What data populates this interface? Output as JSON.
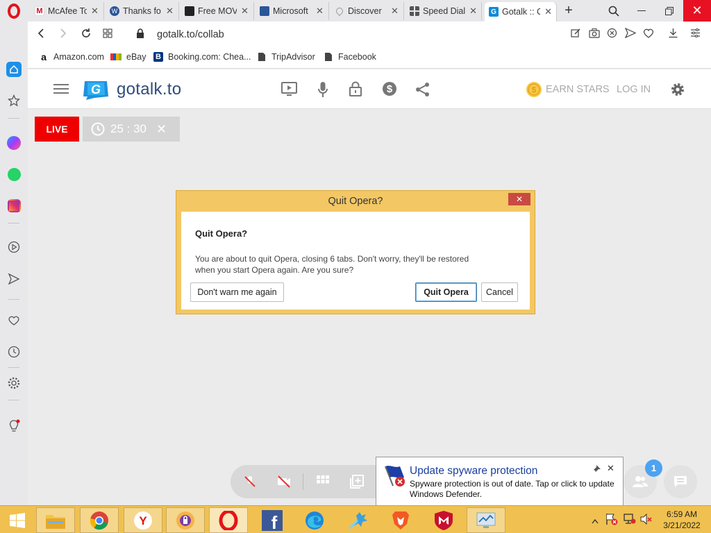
{
  "browser": {
    "tabs": [
      {
        "title": "McAfee To",
        "color": "#c8102e"
      },
      {
        "title": "Thanks fo",
        "color": "#2b579a"
      },
      {
        "title": "Free MOV",
        "color": "#222222"
      },
      {
        "title": "Microsoft",
        "color": "#2b579a"
      },
      {
        "title": "Discover",
        "color": "#999999"
      },
      {
        "title": "Speed Dial",
        "color": "#555555"
      },
      {
        "title": "Gotalk :: C",
        "color": "#0f8bd6"
      }
    ],
    "address": "gotalk.to/collab",
    "bookmarks": [
      {
        "label": "Amazon.com",
        "icon": "amazon-icon"
      },
      {
        "label": "eBay",
        "icon": "ebay-icon"
      },
      {
        "label": "Booking.com: Chea...",
        "icon": "booking-icon"
      },
      {
        "label": "TripAdvisor",
        "icon": "page-icon"
      },
      {
        "label": "Facebook",
        "icon": "page-icon"
      }
    ]
  },
  "site": {
    "logo_text": "gotalk.to",
    "earn_stars": "EARN STARS",
    "login": "LOG IN",
    "live_label": "LIVE",
    "timer": "25 : 30",
    "badge_count": "1"
  },
  "dialog": {
    "window_title": "Quit Opera?",
    "heading": "Quit Opera?",
    "message_line1": "You are about to quit Opera, closing 6 tabs. Don't worry, they'll be restored",
    "message_line2": "when you start Opera again. Are you sure?",
    "dont_warn": "Don't warn me again",
    "quit": "Quit Opera",
    "cancel": "Cancel"
  },
  "notification": {
    "title": "Update spyware protection",
    "line1": "Spyware protection is out of date. Tap or click to update",
    "line2": "Windows Defender."
  },
  "taskbar": {
    "time": "6:59 AM",
    "date": "3/21/2022"
  },
  "colors": {
    "opera_red": "#e3141a",
    "live_red": "#ee0000",
    "taskbar": "#f0c150",
    "dialog_frame": "#f3c764",
    "gotalk_blue": "#1e90e0"
  }
}
